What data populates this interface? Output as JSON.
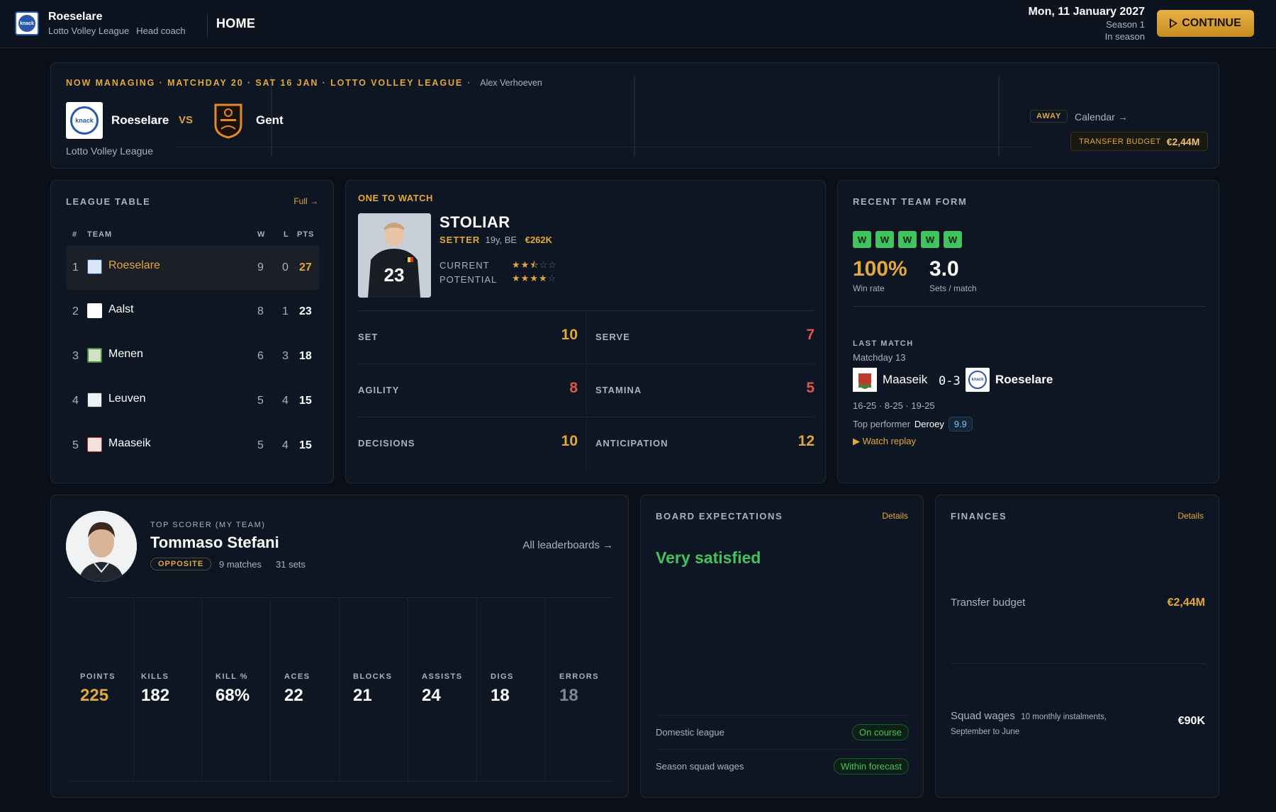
{
  "topbar": {
    "club_name": "Roeselare",
    "league": "Lotto Volley League",
    "role": "Head coach",
    "section": "HOME",
    "date": "Mon, 11 January 2027",
    "season": "Season 1",
    "phase": "In season",
    "continue_label": "CONTINUE"
  },
  "next_match": {
    "header": "NOW MANAGING · MATCHDAY 20 · SAT 16 JAN · LOTTO VOLLEY LEAGUE",
    "separator": "·",
    "manager": "Alex Verhoeven",
    "home_team": "Roeselare",
    "vs": "VS",
    "away_team": "Gent",
    "league": "Lotto Volley League",
    "venue_badge": "AWAY",
    "calendar_link": "Calendar →",
    "transfer_budget_label": "TRANSFER BUDGET",
    "transfer_budget_value": "€2,44M"
  },
  "league_table": {
    "title": "LEAGUE TABLE",
    "full_link": "Full →",
    "headers": {
      "pos": "#",
      "team": "TEAM",
      "w": "W",
      "l": "L",
      "pts": "PTS"
    },
    "rows": [
      {
        "pos": "1",
        "team": "Roeselare",
        "w": "9",
        "l": "0",
        "pts": "27"
      },
      {
        "pos": "2",
        "team": "Aalst",
        "w": "8",
        "l": "1",
        "pts": "23"
      },
      {
        "pos": "3",
        "team": "Menen",
        "w": "6",
        "l": "3",
        "pts": "18"
      },
      {
        "pos": "4",
        "team": "Leuven",
        "w": "5",
        "l": "4",
        "pts": "15"
      },
      {
        "pos": "5",
        "team": "Maaseik",
        "w": "5",
        "l": "4",
        "pts": "15"
      }
    ]
  },
  "one_to_watch": {
    "title": "ONE TO WATCH",
    "name": "STOLIAR",
    "position": "SETTER",
    "age_nat": "19y, BE",
    "value": "€262K",
    "shirt_number": "23",
    "current_label": "CURRENT",
    "potential_label": "POTENTIAL",
    "current_stars": 2.5,
    "potential_stars": 4,
    "attributes": [
      {
        "name": "SET",
        "value": "10",
        "color": "#e3a83a"
      },
      {
        "name": "SERVE",
        "value": "7",
        "color": "#e0574a"
      },
      {
        "name": "AGILITY",
        "value": "8",
        "color": "#e0574a"
      },
      {
        "name": "STAMINA",
        "value": "5",
        "color": "#e0574a"
      },
      {
        "name": "DECISIONS",
        "value": "10",
        "color": "#e3a83a"
      },
      {
        "name": "ANTICIPATION",
        "value": "12",
        "color": "#e3a83a"
      }
    ]
  },
  "recent_form": {
    "title": "RECENT TEAM FORM",
    "results": [
      "W",
      "W",
      "W",
      "W",
      "W"
    ],
    "win_rate": "100%",
    "win_rate_label": "Win rate",
    "sets_per_match": "3.0",
    "sets_per_match_label": "Sets / match",
    "last_match_label": "LAST MATCH",
    "last_match_day": "Matchday 13",
    "home_team": "Maaseik",
    "score": "0-3",
    "away_team": "Roeselare",
    "set_scores": "16-25 · 8-25 · 19-25",
    "top_performer_label": "Top performer",
    "top_performer": "Deroey",
    "top_performer_rating": "9.9",
    "replay_link": "▶ Watch replay"
  },
  "top_scorer": {
    "label": "TOP SCORER (MY TEAM)",
    "name": "Tommaso Stefani",
    "position": "OPPOSITE",
    "matches": "9 matches",
    "sets": "31 sets",
    "leaderboards_link": "All leaderboards →",
    "stats": [
      {
        "label": "POINTS",
        "value": "225",
        "color": "#e3a83a"
      },
      {
        "label": "KILLS",
        "value": "182",
        "color": "#ffffff"
      },
      {
        "label": "KILL %",
        "value": "68%",
        "color": "#ffffff"
      },
      {
        "label": "ACES",
        "value": "22",
        "color": "#ffffff"
      },
      {
        "label": "BLOCKS",
        "value": "21",
        "color": "#ffffff"
      },
      {
        "label": "ASSISTS",
        "value": "24",
        "color": "#ffffff"
      },
      {
        "label": "DIGS",
        "value": "18",
        "color": "#ffffff"
      },
      {
        "label": "ERRORS",
        "value": "18",
        "color": "#7d8593"
      }
    ]
  },
  "board": {
    "title": "BOARD EXPECTATIONS",
    "details_link": "Details",
    "status": "Very satisfied",
    "items": [
      {
        "name": "Domestic league",
        "badge": "On course"
      },
      {
        "name": "Season squad wages",
        "badge": "Within forecast"
      }
    ]
  },
  "finances": {
    "title": "FINANCES",
    "details_link": "Details",
    "transfer_budget_label": "Transfer budget",
    "transfer_budget_value": "€2,44M",
    "squad_wages_label": "Squad wages",
    "squad_wages_note": "10 monthly instalments, September to June",
    "squad_wages_value": "€90K",
    "accent": "#e3a83a"
  }
}
